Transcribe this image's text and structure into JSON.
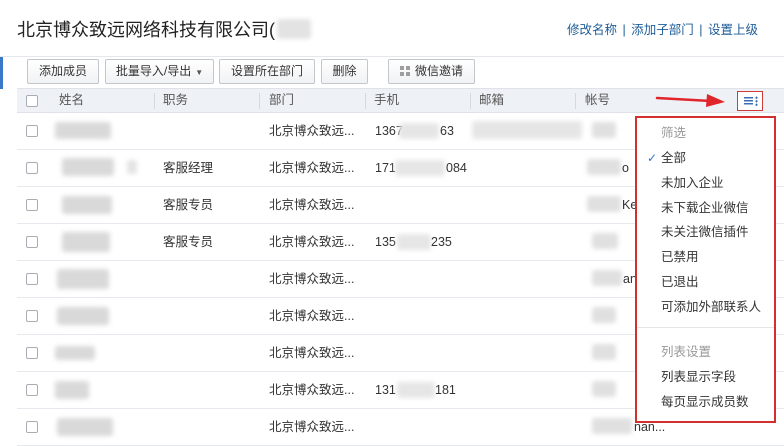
{
  "header": {
    "company_name": "北京博众致远网络科技有限公司(",
    "links": [
      "修改名称",
      "添加子部门",
      "设置上级"
    ],
    "link_separator": "|"
  },
  "toolbar": {
    "add_member": "添加成员",
    "batch_import_export": "批量导入/导出",
    "set_department": "设置所在部门",
    "delete": "删除",
    "wechat_invite": "微信邀请"
  },
  "table": {
    "columns": [
      "姓名",
      "职务",
      "部门",
      "手机",
      "邮箱",
      "帐号"
    ],
    "rows": [
      {
        "name": "",
        "title": "",
        "department": "北京博众致远...",
        "phone_prefix": "1367",
        "phone_suffix": "63",
        "account_suffix": ""
      },
      {
        "name": "",
        "title": "客服经理",
        "department": "北京博众致远...",
        "phone_prefix": "171",
        "phone_suffix": "084",
        "account_suffix": "o"
      },
      {
        "name": "",
        "title": "客服专员",
        "department": "北京博众致远...",
        "phone_prefix": "",
        "phone_suffix": "",
        "account_suffix": "Ke"
      },
      {
        "name": "",
        "title": "客服专员",
        "department": "北京博众致远...",
        "phone_prefix": "135",
        "phone_suffix": "235",
        "account_suffix": ""
      },
      {
        "name": "",
        "title": "",
        "department": "北京博众致远...",
        "phone_prefix": "",
        "phone_suffix": "",
        "account_suffix": "an"
      },
      {
        "name": "",
        "title": "",
        "department": "北京博众致远...",
        "phone_prefix": "",
        "phone_suffix": "",
        "account_suffix": ""
      },
      {
        "name": "",
        "title": "",
        "department": "北京博众致远...",
        "phone_prefix": "",
        "phone_suffix": "",
        "account_suffix": ""
      },
      {
        "name": "",
        "title": "",
        "department": "北京博众致远...",
        "phone_prefix": "131",
        "phone_suffix": "181",
        "account_suffix": ""
      },
      {
        "name": "",
        "title": "",
        "department": "北京博众致远...",
        "phone_prefix": "",
        "phone_suffix": "",
        "account_suffix": "nan..."
      }
    ]
  },
  "dropdown": {
    "filter_title": "筛选",
    "filter_items": [
      {
        "label": "全部",
        "checked": true
      },
      {
        "label": "未加入企业",
        "checked": false
      },
      {
        "label": "未下载企业微信",
        "checked": false
      },
      {
        "label": "未关注微信插件",
        "checked": false
      },
      {
        "label": "已禁用",
        "checked": false
      },
      {
        "label": "已退出",
        "checked": false
      },
      {
        "label": "可添加外部联系人",
        "checked": false
      }
    ],
    "list_settings_title": "列表设置",
    "list_items": [
      "列表显示字段",
      "每页显示成员数"
    ]
  },
  "colors": {
    "link": "#1d5c98",
    "accent": "#3b77c9",
    "highlight": "#d42f2f",
    "check": "#3a77c6"
  }
}
